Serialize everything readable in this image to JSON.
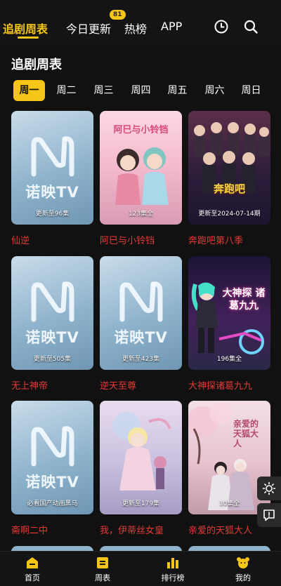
{
  "topnav": {
    "items": [
      {
        "label": "追剧周表",
        "active": true
      },
      {
        "label": "今日更新",
        "active": false
      },
      {
        "label": "热榜",
        "active": false
      },
      {
        "label": "APP",
        "active": false
      }
    ],
    "badge_count": "81",
    "icons": [
      "history-icon",
      "search-icon"
    ],
    "accent_color": "#f5c518"
  },
  "section_title": "追剧周表",
  "weekdays": [
    {
      "label": "周一",
      "active": true
    },
    {
      "label": "周二",
      "active": false
    },
    {
      "label": "周三",
      "active": false
    },
    {
      "label": "周四",
      "active": false
    },
    {
      "label": "周五",
      "active": false
    },
    {
      "label": "周六",
      "active": false
    },
    {
      "label": "周日",
      "active": false
    }
  ],
  "logo_text": "诺映TV",
  "shows": [
    {
      "title": "仙逆",
      "status": "更新至96集"
    },
    {
      "title": "阿巳与小铃铛",
      "status": "123集全",
      "poster_text": "阿巳与小铃铛"
    },
    {
      "title": "奔跑吧第八季",
      "status": "更新至2024-07-14期",
      "poster_text": "奔跑吧"
    },
    {
      "title": "无上神帝",
      "status": "更新至505集"
    },
    {
      "title": "逆天至尊",
      "status": "更新至423集"
    },
    {
      "title": "大神探诸葛九九",
      "status": "196集全",
      "poster_text": "大神探 诸葛九九"
    },
    {
      "title": "斋啊二中",
      "status": "必看国产动画黑马"
    },
    {
      "title": "我，伊蒂丝女皇",
      "status": "更新至179集"
    },
    {
      "title": "亲爱的天狐大人",
      "status": "30集全",
      "poster_text": "亲爱的天狐大人"
    }
  ],
  "tabbar": [
    {
      "label": "首页",
      "icon": "home-icon"
    },
    {
      "label": "周表",
      "icon": "calendar-icon"
    },
    {
      "label": "排行榜",
      "icon": "chart-icon"
    },
    {
      "label": "我的",
      "icon": "profile-icon"
    }
  ],
  "float_buttons": [
    "brightness-icon",
    "feedback-icon"
  ],
  "title_color": "#e53935"
}
